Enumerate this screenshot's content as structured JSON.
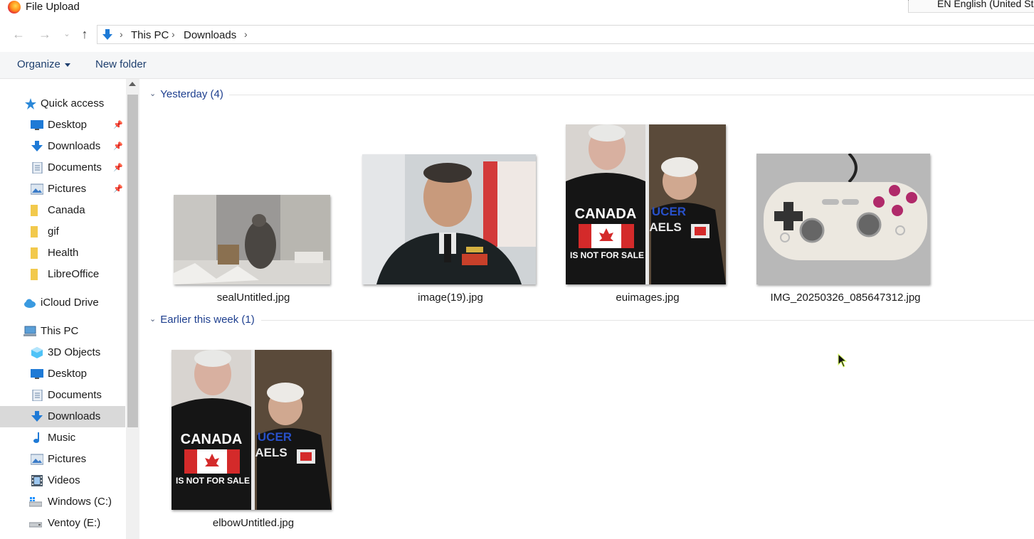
{
  "window": {
    "title": "File Upload",
    "language": "EN English (United Sta"
  },
  "address": {
    "crumbs": [
      "This PC",
      "Downloads"
    ]
  },
  "toolbar": {
    "organize": "Organize",
    "new_folder": "New folder"
  },
  "sidebar": {
    "quick_access": "Quick access",
    "quick_items": [
      "Desktop",
      "Downloads",
      "Documents",
      "Pictures",
      "Canada",
      "gif",
      "Health",
      "LibreOffice"
    ],
    "icloud": "iCloud Drive",
    "this_pc": "This PC",
    "pc_items": [
      "3D Objects",
      "Desktop",
      "Documents",
      "Downloads",
      "Music",
      "Pictures",
      "Videos",
      "Windows (C:)",
      "Ventoy (E:)"
    ]
  },
  "groups": [
    {
      "label": "Yesterday (4)",
      "files": [
        "sealUntitled.jpg",
        "image(19).jpg",
        "euimages.jpg",
        "IMG_20250326_085647312.jpg"
      ]
    },
    {
      "label": "Earlier this week (1)",
      "files": [
        "elbowUntitled.jpg"
      ]
    }
  ],
  "tshirt": {
    "line1": "CANADA",
    "line2": "IS NOT FOR SALE",
    "banner": "UCER",
    "banner2": "AELS"
  },
  "colors": {
    "accent": "#1e3f8f",
    "selected_bg": "#d9d9d9",
    "folder": "#f2c94c",
    "download_blue": "#1e7ad6"
  }
}
